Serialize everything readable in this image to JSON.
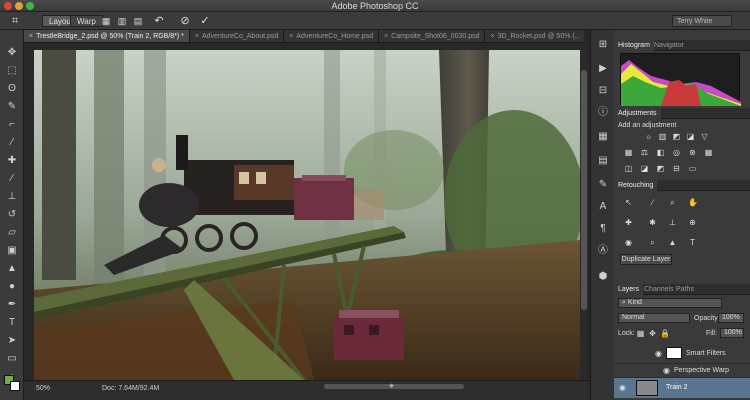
{
  "app": {
    "title": "Adobe Photoshop CC"
  },
  "options_bar": {
    "layout_label": "Layout",
    "warp_label": "Warp",
    "workspace_user": "Terry White"
  },
  "tabs": [
    {
      "label": "TrestleBridge_2.psd @ 50% (Train 2, RGB/8*) *",
      "active": true
    },
    {
      "label": "AdventureCo_About.psd",
      "active": false
    },
    {
      "label": "AdventureCo_Home.psd",
      "active": false
    },
    {
      "label": "Campsite_Shot06_0030.psd",
      "active": false
    },
    {
      "label": "3D_Rocket.psd @ 50% (...",
      "active": false
    }
  ],
  "status": {
    "zoom": "50%",
    "doc_size": "Doc: 7.64M/92.4M"
  },
  "panels": {
    "histogram": {
      "tabs": [
        "Histogram",
        "Navigator"
      ]
    },
    "adjustments": {
      "title": "Adjustments",
      "prompt": "Add an adjustment"
    },
    "retouching": {
      "title": "Retouching",
      "duplicate_button": "Duplicate Layer"
    },
    "layers": {
      "tabs": [
        "Layers",
        "Channels",
        "Paths"
      ],
      "kind_filter": "Kind",
      "blend_mode": "Normal",
      "opacity_label": "Opacity:",
      "opacity_value": "100%",
      "lock_label": "Lock:",
      "fill_label": "Fill:",
      "fill_value": "100%",
      "rows": [
        {
          "name": "Smart Filters"
        },
        {
          "name": "Perspective Warp"
        },
        {
          "name": "Train 2"
        }
      ]
    }
  },
  "colors": {
    "accent_selected_layer": "#6688aa",
    "foreground_swatch": "#6fae4a",
    "background_swatch": "#ffffff"
  }
}
